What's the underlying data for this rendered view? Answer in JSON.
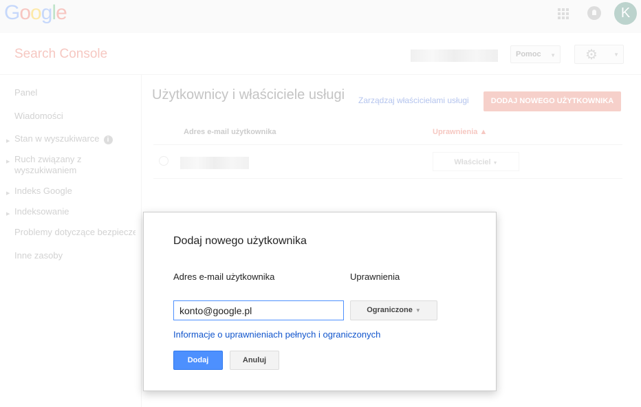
{
  "header": {
    "logo": "Google",
    "avatar_initial": "K",
    "apps_icon": "apps-grid-icon",
    "notifications_icon": "bell-icon"
  },
  "app": {
    "title": "Search Console",
    "help_label": "Pomoc",
    "settings_icon": "gear-icon"
  },
  "sidebar": {
    "items": [
      {
        "label": "Panel",
        "expandable": false
      },
      {
        "label": "Wiadomości",
        "expandable": false
      },
      {
        "label": "Stan w wyszukiwarce",
        "expandable": true,
        "info": "i"
      },
      {
        "label": "Ruch związany z wyszukiwaniem",
        "expandable": true
      },
      {
        "label": "Indeks Google",
        "expandable": true
      },
      {
        "label": "Indeksowanie",
        "expandable": true
      },
      {
        "label": "Problemy dotyczące bezpieczeństwa",
        "expandable": false
      },
      {
        "label": "Inne zasoby",
        "expandable": false
      }
    ]
  },
  "main": {
    "title": "Użytkownicy i właściciele usługi",
    "manage_owners_link": "Zarządzaj właścicielami usługi",
    "add_user_button": "DODAJ NOWEGO UŻYTKOWNIKA",
    "table": {
      "columns": [
        "Adres e-mail użytkownika",
        "Uprawnienia ▲"
      ],
      "rows": [
        {
          "permission": "Właściciel"
        }
      ]
    }
  },
  "dialog": {
    "title": "Dodaj nowego użytkownika",
    "email_label": "Adres e-mail użytkownika",
    "permission_label": "Uprawnienia",
    "email_value": "konto@google.pl",
    "permission_value": "Ograniczone",
    "info_link": "Informacje o uprawnieniach pełnych i ograniczonych",
    "submit": "Dodaj",
    "cancel": "Anuluj"
  },
  "colors": {
    "primary_button": "#4d90fe",
    "accent": "#dd4b39",
    "link": "#1155cc"
  }
}
